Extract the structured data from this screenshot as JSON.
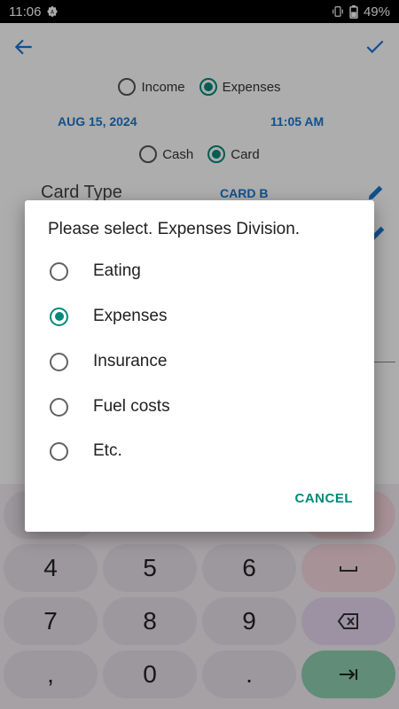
{
  "status_bar": {
    "time": "11:06",
    "battery": "49%"
  },
  "app": {
    "type_options": [
      {
        "label": "Income",
        "selected": false
      },
      {
        "label": "Expenses",
        "selected": true
      }
    ],
    "date": "AUG 15, 2024",
    "time": "11:05 AM",
    "payment_options": [
      {
        "label": "Cash",
        "selected": false
      },
      {
        "label": "Card",
        "selected": true
      }
    ],
    "card_type_label": "Card Type",
    "card_type_value": "CARD B"
  },
  "keypad": {
    "row1": [
      "4",
      "5",
      "6"
    ],
    "row2": [
      "7",
      "8",
      "9"
    ],
    "row3": [
      ",",
      "0",
      "."
    ]
  },
  "dialog": {
    "title": "Please select. Expenses Division.",
    "options": [
      {
        "label": "Eating",
        "selected": false
      },
      {
        "label": "Expenses",
        "selected": true
      },
      {
        "label": "Insurance",
        "selected": false
      },
      {
        "label": "Fuel costs",
        "selected": false
      },
      {
        "label": "Etc.",
        "selected": false
      }
    ],
    "cancel_label": "CANCEL"
  },
  "colors": {
    "accent": "#00897b",
    "link_blue": "#1976d2",
    "scrim": "rgba(0,0,0,0.32)"
  }
}
